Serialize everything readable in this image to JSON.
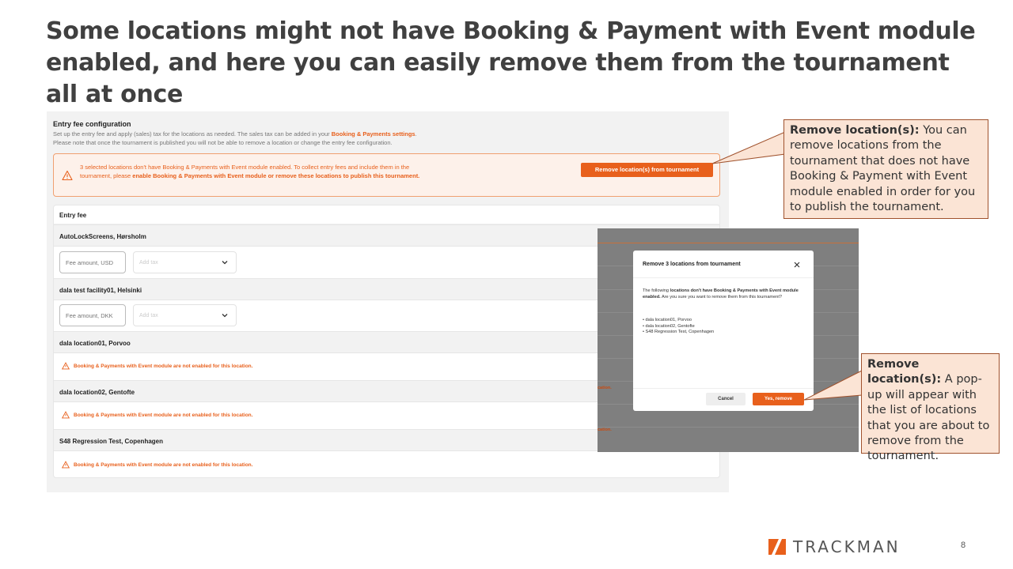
{
  "slide": {
    "title": "Some locations might not have Booking & Payment with Event module enabled, and here you can easily remove them from the tournament all at once",
    "page_number": "8",
    "logo_text": "TRACKMAN"
  },
  "config": {
    "title": "Entry fee configuration",
    "desc_part1": "Set up the entry fee and apply (sales) tax for the locations as needed. The sales tax can be added in your ",
    "desc_link": "Booking & Payments settings",
    "desc_part2": ".",
    "desc_line2": "Please note that once the tournament is published you will not be able to remove a location or change the entry fee configuration."
  },
  "warning": {
    "text_part1": "3 selected locations don't have Booking & Payments with Event module enabled. To collect entry fees and include them in the tournament, please ",
    "text_bold": "enable Booking & Payments with Event module or remove these locations to publish this tournament.",
    "button_label": "Remove location(s) from tournament"
  },
  "entry_fee": {
    "header": "Entry fee",
    "locations": [
      {
        "name": "AutoLockScreens, Hørsholm",
        "fee_placeholder": "Fee amount, USD",
        "tax_placeholder": "Add tax"
      },
      {
        "name": "dala test facility01, Helsinki",
        "fee_placeholder": "Fee amount, DKK",
        "tax_placeholder": "Add tax"
      },
      {
        "name": "dala location01, Porvoo",
        "warning": "Booking & Payments with Event module are not enabled for this location."
      },
      {
        "name": "dala location02, Gentofte",
        "warning": "Booking & Payments with Event module are not enabled for this location."
      },
      {
        "name": "S48 Regression Test, Copenhagen",
        "warning": "Booking & Payments with Event module are not enabled for this location."
      }
    ]
  },
  "overlay": {
    "cut_text_1": "cation.",
    "cut_text_2": "cation."
  },
  "modal": {
    "title": "Remove 3 locations from tournament",
    "body_part1": "The following ",
    "body_bold": "locations don't have Booking & Payments with Event module enabled.",
    "body_part2": " Are you sure you want to remove them from this tournament?",
    "items": [
      "• dala location01, Porvoo",
      "• dala location02, Gentofte",
      "• S48 Regression Test, Copenhagen"
    ],
    "cancel_label": "Cancel",
    "confirm_label": "Yes, remove"
  },
  "callouts": {
    "first": {
      "bold": "Remove location(s):",
      "text": " You can remove locations from the tournament that does not have Booking & Payment with Event module enabled in order for you to publish the tournament."
    },
    "second": {
      "bold": "Remove location(s):",
      "text": " A pop-up will appear with the list of locations that you are about to remove from the tournament."
    }
  },
  "colors": {
    "accent": "#e8601c",
    "callout_bg": "#fbe4d5",
    "title_text": "#404040"
  }
}
